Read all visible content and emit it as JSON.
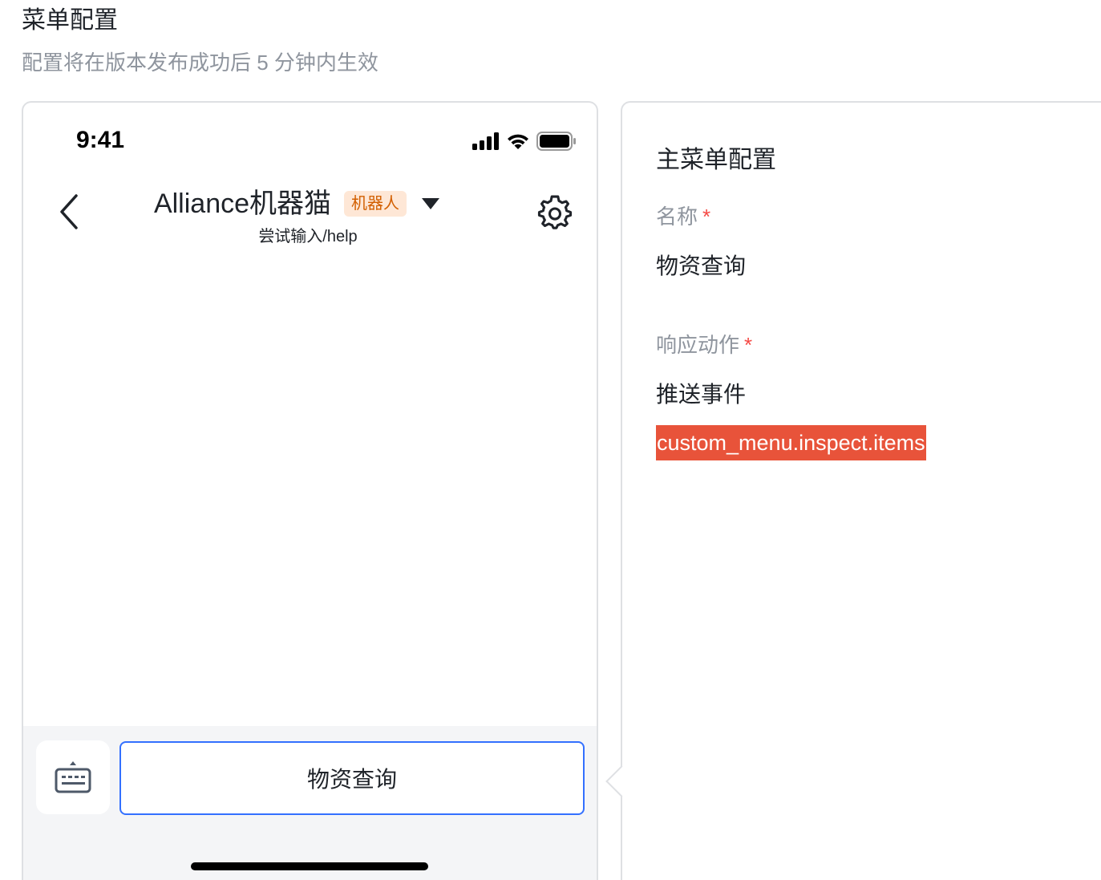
{
  "header": {
    "title": "菜单配置",
    "subtitle": "配置将在版本发布成功后 5 分钟内生效"
  },
  "phone": {
    "status_time": "9:41",
    "chat_title": "Alliance机器猫",
    "robot_badge": "机器人",
    "chat_hint": "尝试输入/help",
    "menu_button_label": "物资查询"
  },
  "config": {
    "title": "主菜单配置",
    "name_label": "名称",
    "name_required": "*",
    "name_value": "物资查询",
    "action_label": "响应动作",
    "action_required": "*",
    "action_value": "推送事件",
    "event_key": "custom_menu.inspect.items"
  },
  "colors": {
    "accent": "#3370ff",
    "required": "#f54a45",
    "event_highlight": "#e8533a",
    "badge_bg": "#fee7d6",
    "badge_text": "#d25f00"
  },
  "icons": [
    "signal-icon",
    "wifi-icon",
    "battery-icon",
    "back-arrow-icon",
    "caret-down-icon",
    "gear-icon",
    "keyboard-icon"
  ]
}
